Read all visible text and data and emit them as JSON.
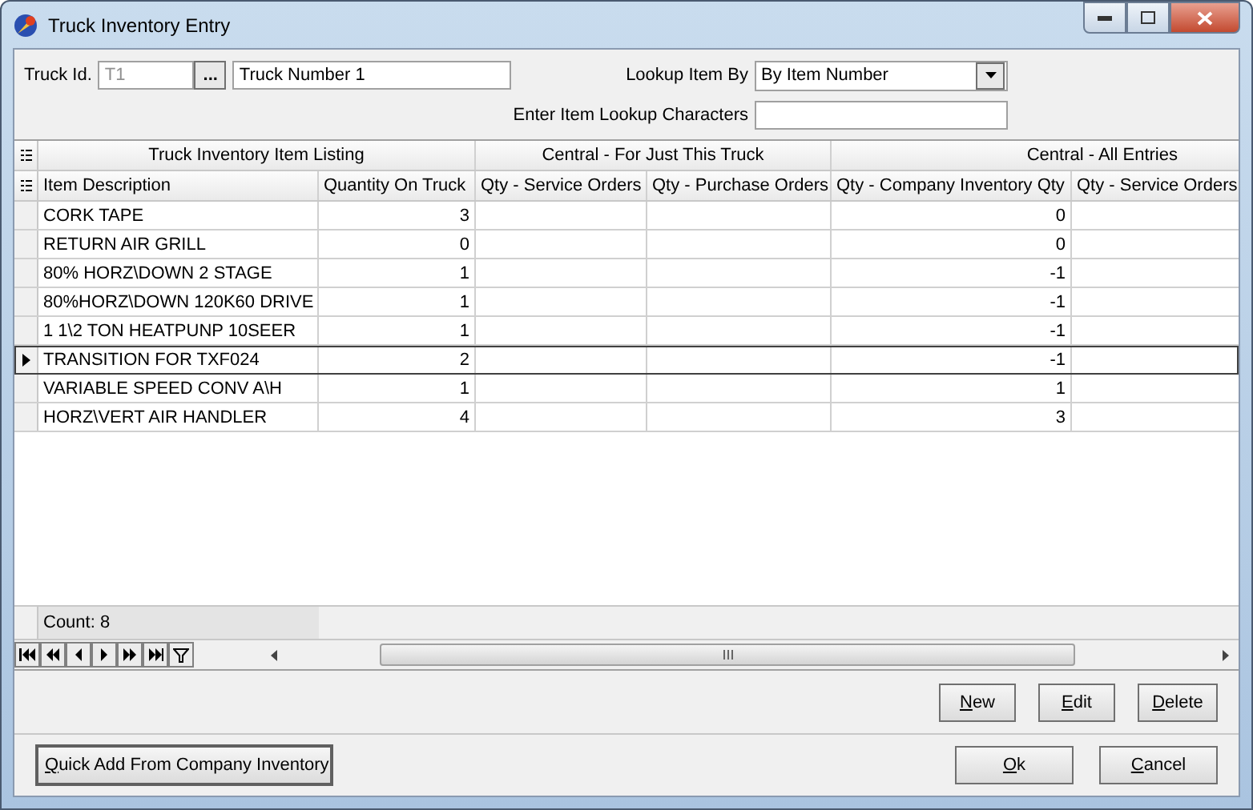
{
  "window": {
    "title": "Truck Inventory Entry"
  },
  "form": {
    "truck_id_label": "Truck Id.",
    "truck_id": {
      "value": "T1",
      "disabled": true
    },
    "browse_button": "...",
    "truck_name": "Truck Number 1",
    "lookup_label": "Lookup Item By",
    "lookup_value": "By Item Number",
    "lookup_chars_label": "Enter Item Lookup Characters"
  },
  "grid": {
    "groups": [
      {
        "label": "Truck Inventory Item Listing",
        "columns": [
          {
            "label": "Item Description",
            "kind": "text"
          },
          {
            "label": "Quantity On Truck",
            "kind": "number"
          }
        ]
      },
      {
        "label": "Central - For Just This Truck",
        "columns": [
          {
            "label": "Qty - Service Orders",
            "kind": "number"
          },
          {
            "label": "Qty - Purchase Orders",
            "kind": "number"
          }
        ]
      },
      {
        "label": "Central - All Entries",
        "columns": [
          {
            "label": "Qty - Company Inventory Qty",
            "kind": "number"
          },
          {
            "label": "Qty - Service Orders",
            "kind": "number"
          }
        ]
      }
    ],
    "rows": [
      {
        "cells": [
          "CORK TAPE",
          "3",
          null,
          null,
          "0"
        ],
        "selected": false
      },
      {
        "cells": [
          "RETURN AIR GRILL",
          "0",
          null,
          null,
          "0"
        ],
        "selected": false
      },
      {
        "cells": [
          "80% HORZ\\DOWN 2 STAGE",
          "1",
          null,
          null,
          "-1"
        ],
        "selected": false
      },
      {
        "cells": [
          "80%HORZ\\DOWN 120K60 DRIVE",
          "1",
          null,
          null,
          "-1"
        ],
        "selected": false
      },
      {
        "cells": [
          "1 1\\2 TON HEATPUNP 10SEER",
          "1",
          null,
          null,
          "-1"
        ],
        "selected": false
      },
      {
        "cells": [
          "TRANSITION FOR TXF024",
          "2",
          null,
          null,
          "-1"
        ],
        "selected": true
      },
      {
        "cells": [
          "VARIABLE SPEED CONV A\\H",
          "1",
          null,
          null,
          "1"
        ],
        "selected": false
      },
      {
        "cells": [
          "HORZ\\VERT AIR HANDLER",
          "4",
          null,
          null,
          "3"
        ],
        "selected": false
      }
    ],
    "count": "Count: 8"
  },
  "row_buttons": [
    "New",
    "Edit",
    "Delete"
  ],
  "quick_add_button": "Quick Add From Company Inventory",
  "dialog_buttons": [
    "Ok",
    "Cancel"
  ]
}
